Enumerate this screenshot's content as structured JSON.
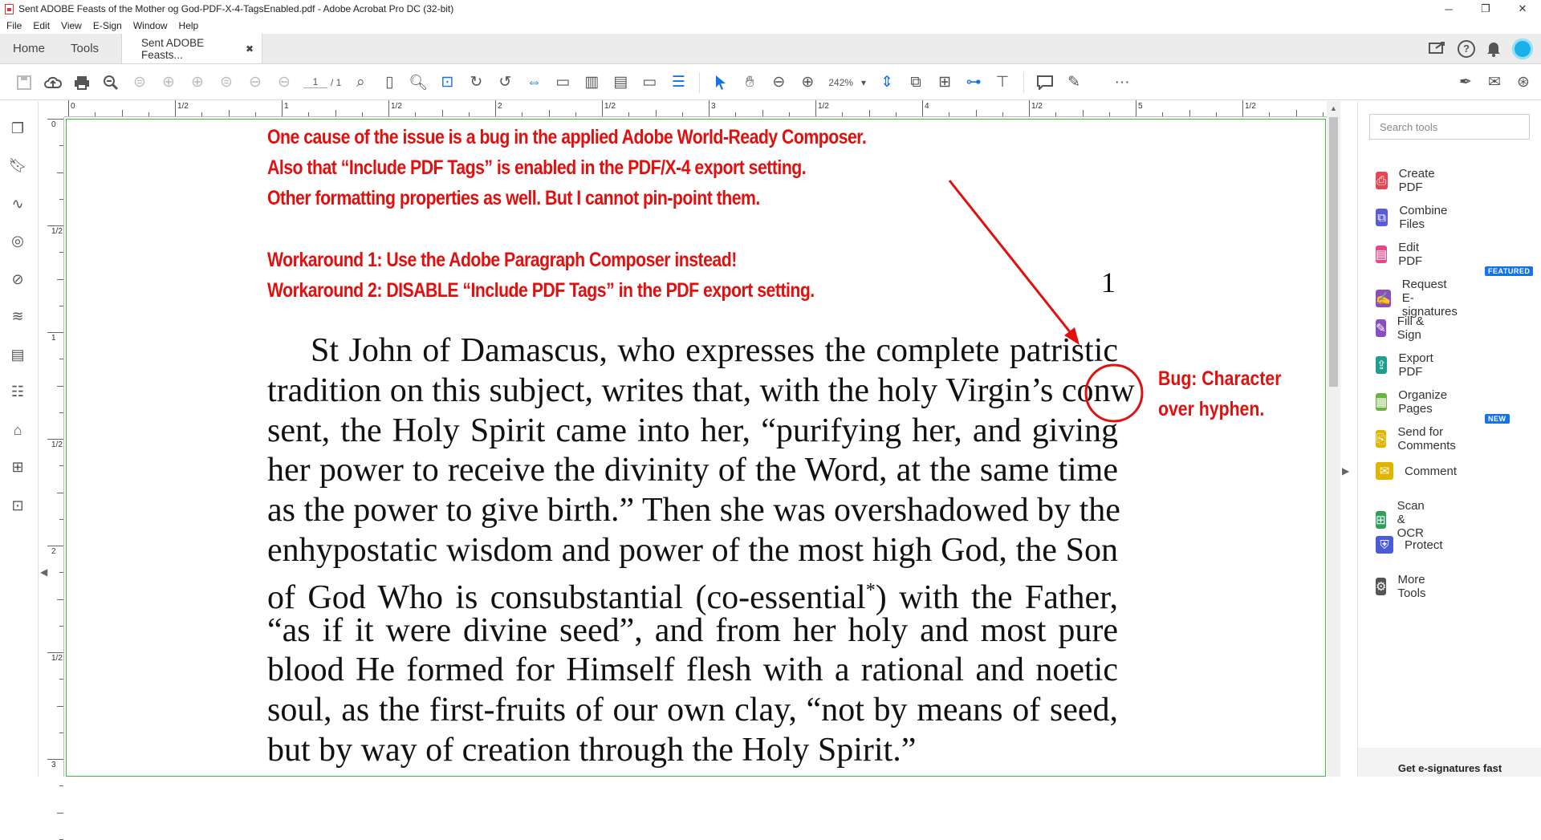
{
  "window": {
    "title": "Sent ADOBE Feasts of the Mother og God-PDF-X-4-TagsEnabled.pdf - Adobe Acrobat Pro DC (32-bit)",
    "minimize": "─",
    "maximize": "❐",
    "close": "✕"
  },
  "menu": [
    "File",
    "Edit",
    "View",
    "E-Sign",
    "Window",
    "Help"
  ],
  "tabs": {
    "home": "Home",
    "tools": "Tools",
    "document": "Sent ADOBE Feasts...",
    "close": "✖"
  },
  "toolbar": {
    "page_current": "1",
    "page_total": "/ 1",
    "zoom": "242%",
    "more": "···"
  },
  "rulers": {
    "h_labels": [
      "0",
      "1/2",
      "1",
      "1/2",
      "2",
      "1/2",
      "3",
      "1/2",
      "4",
      "1/2",
      "5",
      "1/2"
    ],
    "v_labels": [
      "0",
      "1/2",
      "1",
      "1/2",
      "2",
      "1/2",
      "3"
    ]
  },
  "annotation": {
    "line1": "One cause of the issue is a bug in the applied Adobe World-Ready Composer.",
    "line2": "Also that “Include PDF Tags” is enabled in the PDF/X-4 export setting.",
    "line3": "Other formatting properties as well. But I cannot pin-point them.",
    "line4": "Workaround 1: Use the Adobe Paragraph Composer instead!",
    "line5": "Workaround 2: DISABLE  “Include PDF Tags”  in the PDF export setting.",
    "bug_line1": "Bug: Character",
    "bug_line2": "over hyphen.",
    "color": "#e0100f"
  },
  "document": {
    "page_number": "1",
    "lines": [
      "St John of Damascus, who expresses the complete patristic",
      "tradition on this subject, writes that, with the holy Virgin’s conw",
      "sent, the Holy Spirit came into her, “purifying her, and giving",
      "her power to receive the divinity of the Word, at the same time",
      "as the power to give birth.” Then she was overshadowed by the",
      "enhypostatic wisdom and power of the most high God, the Son",
      "of God Who is consubstantial (co-essential*) with the Father,",
      "“as if it were divine seed”, and from her holy and most pure",
      "blood He formed for Himself flesh with a rational and noetic",
      "soul, as the first-fruits of our own clay, “not by means of seed,",
      "but by way of creation through the Holy Spirit.”"
    ]
  },
  "tools_panel": {
    "search_placeholder": "Search tools",
    "items": [
      {
        "label": "Create PDF",
        "color": "#e34850"
      },
      {
        "label": "Combine Files",
        "color": "#5b5bd6"
      },
      {
        "label": "Edit PDF",
        "color": "#e34888"
      },
      {
        "label": "Request E-signatures",
        "color": "#8a4fbf",
        "badge": "FEATURED"
      },
      {
        "label": "Fill & Sign",
        "color": "#8a4fbf"
      },
      {
        "label": "Export PDF",
        "color": "#1f9e8e"
      },
      {
        "label": "Organize Pages",
        "color": "#6bb33f"
      },
      {
        "label": "Send for Comments",
        "color": "#e0b400",
        "badge": "NEW"
      },
      {
        "label": "Comment",
        "color": "#e0b400"
      },
      {
        "label": "Scan & OCR",
        "color": "#2ea25a"
      },
      {
        "label": "Protect",
        "color": "#4a5dd9"
      },
      {
        "label": "More Tools",
        "color": "#555555"
      }
    ],
    "promo": "Get e-signatures fast"
  }
}
